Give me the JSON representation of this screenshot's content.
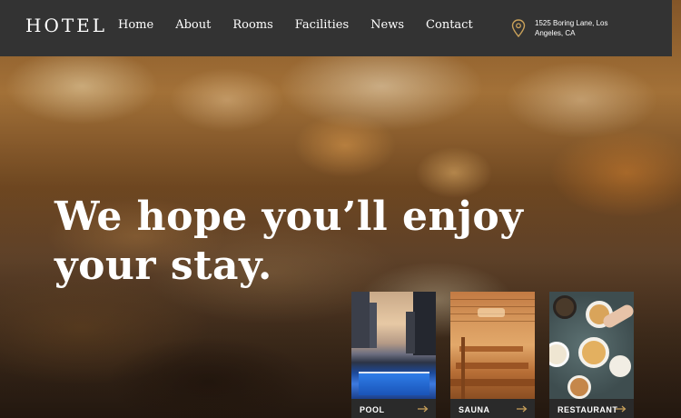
{
  "header": {
    "logo": "HOTEL",
    "nav": [
      "Home",
      "About",
      "Rooms",
      "Facilities",
      "News",
      "Contact"
    ],
    "address_line1": "1525 Boring Lane, Los",
    "address_line2": "Angeles, CA"
  },
  "hero": {
    "headline_line1": "We hope you’ll enjoy",
    "headline_line2": "your stay."
  },
  "cards": [
    {
      "label": "POOL"
    },
    {
      "label": "SAUNA"
    },
    {
      "label": "RESTAURANT"
    }
  ],
  "colors": {
    "header_bg": "#333333",
    "accent": "#c9a15a",
    "card_bar": "#2a2a2a"
  },
  "icons": {
    "address": "map-pin-icon",
    "card_arrow": "arrow-right-icon"
  }
}
